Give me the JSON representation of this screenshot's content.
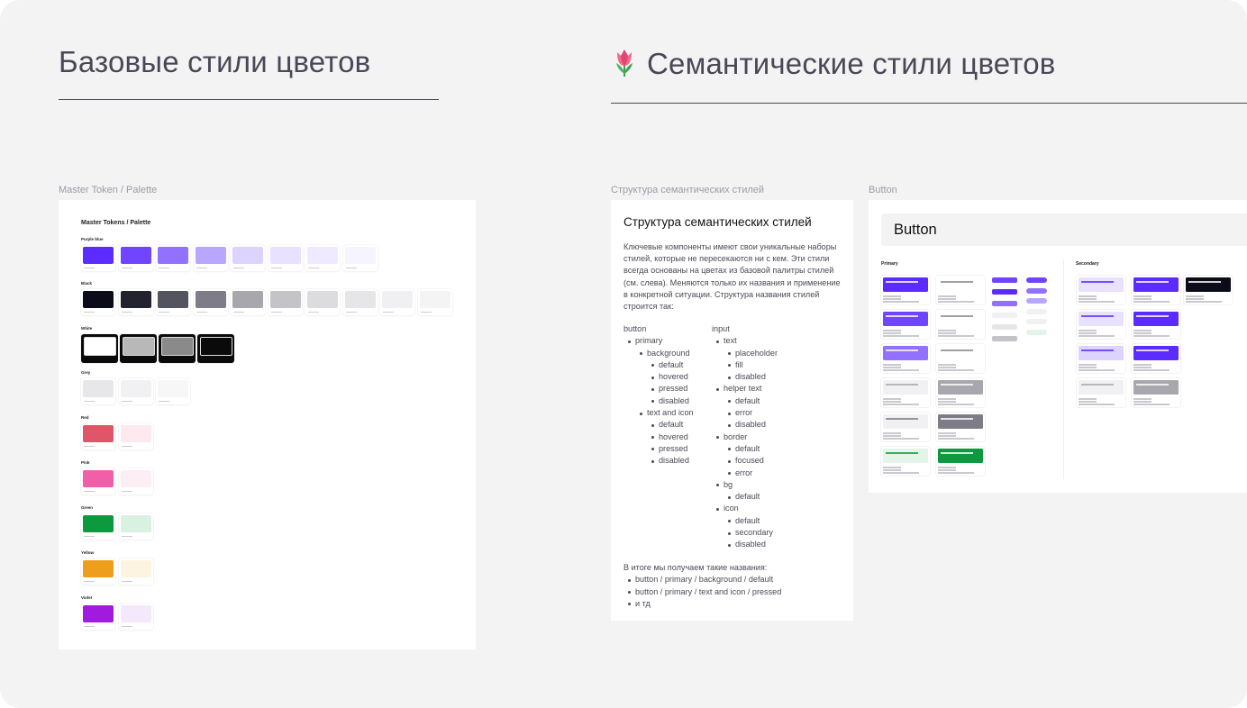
{
  "headings": {
    "base": "Базовые стили цветов",
    "semantic": "Семантические стили цветов"
  },
  "frame_labels": {
    "palette": "Master Token / Palette",
    "structure": "Структура семантических стилей",
    "button": "Button"
  },
  "palette": {
    "title": "Master Tokens / Palette",
    "rows": [
      {
        "label": "Purple blue",
        "colors": [
          "#5b2bff",
          "#6f45ff",
          "#9271ff",
          "#b9a6ff",
          "#dcd3ff",
          "#e8e1ff",
          "#efeaff",
          "#f6f4ff"
        ]
      },
      {
        "label": "Black",
        "colors": [
          "#0b0b1a",
          "#23232f",
          "#545460",
          "#7e7d87",
          "#a7a7ad",
          "#c3c3c8",
          "#dcdcdf",
          "#e6e6e9",
          "#f0f0f2",
          "#f4f4f5"
        ]
      },
      {
        "label": "White",
        "colors": [
          "#ffffff",
          "#b8b8b8",
          "#8a8a8a",
          "#0a0a0a"
        ]
      },
      {
        "label": "Grey",
        "colors": [
          "#e7e7ea",
          "#f1f1f3",
          "#f7f7f8"
        ]
      },
      {
        "label": "Red",
        "colors": [
          "#e05568",
          "#fde9ee"
        ]
      },
      {
        "label": "Pink",
        "colors": [
          "#f05fa8",
          "#fdeef6"
        ]
      },
      {
        "label": "Green",
        "colors": [
          "#0d9a3e",
          "#d9f1e1"
        ]
      },
      {
        "label": "Yellow",
        "colors": [
          "#ee9e1a",
          "#fdf3e1"
        ]
      },
      {
        "label": "Violet",
        "colors": [
          "#a11ae0",
          "#f4e8fd"
        ]
      }
    ]
  },
  "structure": {
    "title": "Структура семантических стилей",
    "body": "Ключевые компоненты имеют свои уникальные наборы стилей, которые не пересекаются ни с кем. Эти стили всегда основаны на цветах из базовой палитры стилей (см. слева). Меняются только их названия и применение в конкретной ситуации. Структура названия стилей строится так:",
    "tree_left": [
      {
        "text": "button",
        "level": 0
      },
      {
        "text": "primary",
        "level": 1
      },
      {
        "text": "background",
        "level": 2
      },
      {
        "text": "default",
        "level": 3
      },
      {
        "text": "hovered",
        "level": 3
      },
      {
        "text": "pressed",
        "level": 3
      },
      {
        "text": "disabled",
        "level": 3
      },
      {
        "text": "text and icon",
        "level": 2
      },
      {
        "text": "default",
        "level": 3
      },
      {
        "text": "hovered",
        "level": 3
      },
      {
        "text": "pressed",
        "level": 3
      },
      {
        "text": "disabled",
        "level": 3
      }
    ],
    "tree_right": [
      {
        "text": "input",
        "level": 0
      },
      {
        "text": "text",
        "level": 1
      },
      {
        "text": "placeholder",
        "level": 2
      },
      {
        "text": "fill",
        "level": 2
      },
      {
        "text": "disabled",
        "level": 2
      },
      {
        "text": "helper text",
        "level": 1
      },
      {
        "text": "default",
        "level": 2
      },
      {
        "text": "error",
        "level": 2
      },
      {
        "text": "disabled",
        "level": 2
      },
      {
        "text": "border",
        "level": 1
      },
      {
        "text": "default",
        "level": 2
      },
      {
        "text": "focused",
        "level": 2
      },
      {
        "text": "error",
        "level": 2
      },
      {
        "text": "bg",
        "level": 1
      },
      {
        "text": "default",
        "level": 2
      },
      {
        "text": "icon",
        "level": 1
      },
      {
        "text": "default",
        "level": 2
      },
      {
        "text": "secondary",
        "level": 2
      },
      {
        "text": "disabled",
        "level": 2
      }
    ],
    "footer_intro": "В итоге мы получаем такие названия:",
    "footer_items": [
      "button / primary / background / default",
      "button / primary / text and icon / pressed",
      "и тд"
    ]
  },
  "button_card": {
    "header": "Button",
    "primary_label": "Primary",
    "secondary_label": "Secondary",
    "primary_bg_colors": [
      "#5b2bff",
      "#6f45ff",
      "#9271ff",
      "#f1f1f3",
      "#f1f1f3",
      "#e3f4e8"
    ],
    "primary_text_colors": [
      "#ffffff",
      "#ffffff",
      "#ffffff",
      "#a7a7ad",
      "#7e7d87",
      "#0d9a3e"
    ],
    "secondary_bg_colors": [
      "#e8e1ff",
      "#e8e1ff",
      "#dcd3ff",
      "#f1f1f3"
    ],
    "secondary_text_colors": [
      "#5b2bff",
      "#5b2bff",
      "#5b2bff",
      "#a7a7ad"
    ]
  }
}
